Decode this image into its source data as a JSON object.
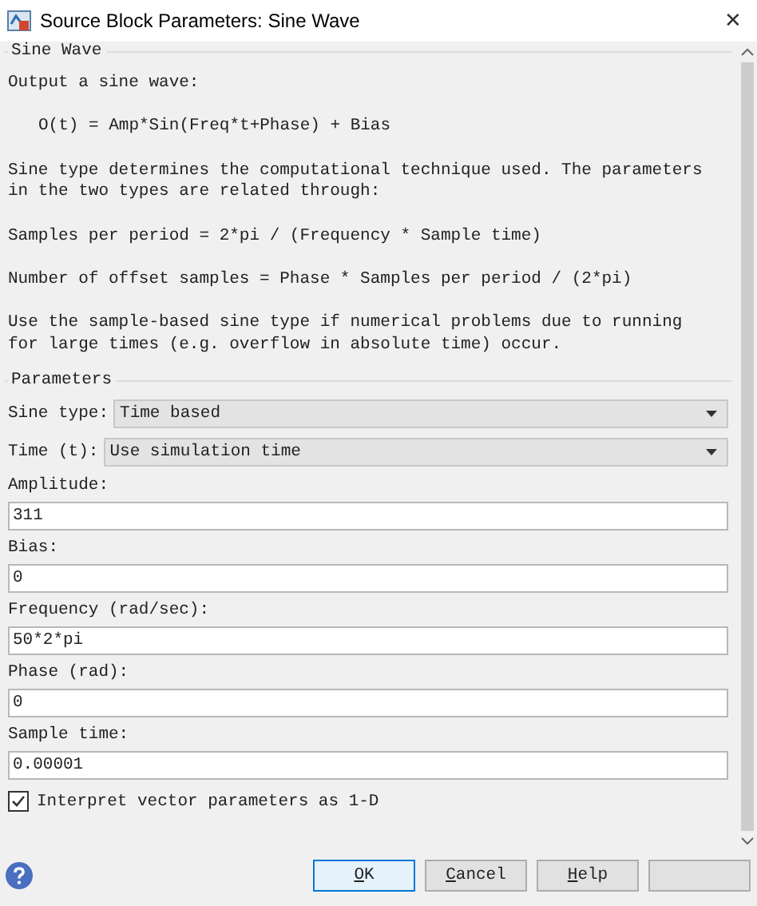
{
  "window": {
    "title": "Source Block Parameters: Sine Wave",
    "close": "✕"
  },
  "description": {
    "title": "Sine Wave",
    "paragraphs": [
      {
        "kind": "text",
        "text": "Output a sine wave:"
      },
      {
        "kind": "formula",
        "text": "O(t) = Amp*Sin(Freq*t+Phase) + Bias"
      },
      {
        "kind": "text",
        "text": "Sine type determines the computational technique used. The parameters\nin the two types are related through:"
      },
      {
        "kind": "text",
        "text": "Samples per period = 2*pi / (Frequency * Sample time)"
      },
      {
        "kind": "text",
        "text": "Number of offset samples = Phase * Samples per period / (2*pi)"
      },
      {
        "kind": "text",
        "text": "Use the sample-based sine type if numerical problems due to running\nfor large times (e.g. overflow in absolute time) occur."
      }
    ]
  },
  "parameters": {
    "title": "Parameters",
    "fields": [
      {
        "kind": "select",
        "label": "Sine type:",
        "value": "Time based"
      },
      {
        "kind": "select",
        "label": "Time (t):",
        "value": "Use simulation time"
      },
      {
        "kind": "input",
        "label": "Amplitude:",
        "value": "311"
      },
      {
        "kind": "input",
        "label": "Bias:",
        "value": "0"
      },
      {
        "kind": "input",
        "label": "Frequency (rad/sec):",
        "value": "50*2*pi"
      },
      {
        "kind": "input",
        "label": "Phase (rad):",
        "value": "0"
      },
      {
        "kind": "input",
        "label": "Sample time:",
        "value": "0.00001"
      }
    ],
    "checkbox": {
      "label": "Interpret vector parameters as 1-D",
      "checked": true
    }
  },
  "buttons": [
    {
      "label": "OK",
      "focused": true
    },
    {
      "label": "Cancel",
      "focused": false
    },
    {
      "label": "Help",
      "focused": false
    },
    {
      "focused": false
    }
  ]
}
